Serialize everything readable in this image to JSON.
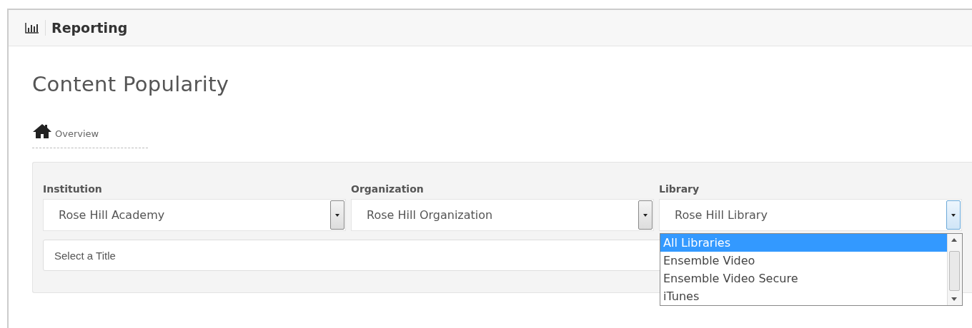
{
  "header": {
    "title": "Reporting"
  },
  "page_title": "Content Popularity",
  "breadcrumb": {
    "label": "Overview"
  },
  "filters": [
    {
      "label": "Institution",
      "value": "Rose Hill Academy",
      "open": false
    },
    {
      "label": "Organization",
      "value": "Rose Hill Organization",
      "open": false
    },
    {
      "label": "Library",
      "value": "Rose Hill Library",
      "open": true,
      "options": [
        {
          "label": "All Libraries",
          "selected": true
        },
        {
          "label": "Ensemble Video",
          "selected": false
        },
        {
          "label": "Ensemble Video Secure",
          "selected": false
        },
        {
          "label": "iTunes",
          "selected": false
        }
      ]
    }
  ],
  "title_field": {
    "placeholder": "Select a Title"
  }
}
